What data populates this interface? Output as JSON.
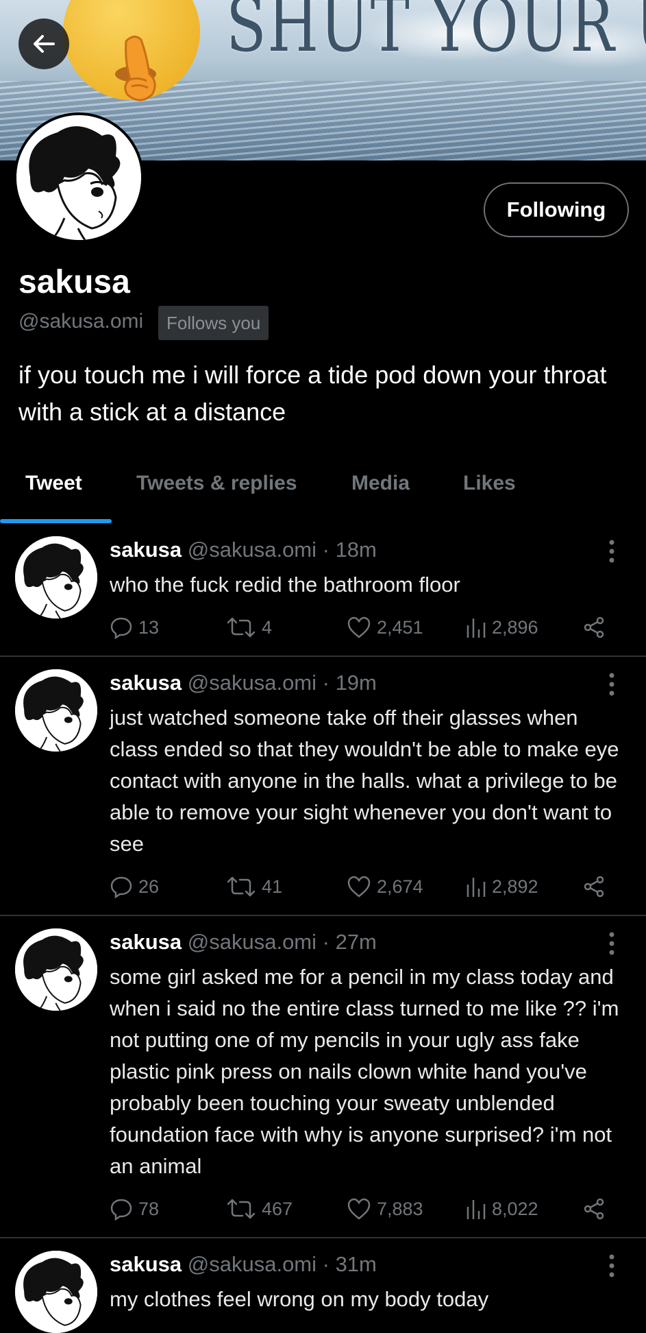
{
  "banner": {
    "text": "SHUT YOUR UP"
  },
  "profile": {
    "name": "sakusa",
    "handle": "@sakusa.omi",
    "follows_you": "Follows you",
    "follow_button": "Following",
    "bio": "if you touch me i will force a tide pod down your throat with a stick at a distance"
  },
  "tabs": [
    "Tweet",
    "Tweets & replies",
    "Media",
    "Likes"
  ],
  "tweets": [
    {
      "name": "sakusa",
      "meta": "@sakusa.omi · 18m",
      "text": "who the fuck redid the bathroom floor",
      "replies": "13",
      "retweets": "4",
      "likes": "2,451",
      "views": "2,896"
    },
    {
      "name": "sakusa",
      "meta": "@sakusa.omi · 19m",
      "text": "just watched someone take off their glasses when class ended so that they wouldn't be able to make eye contact with anyone in the halls. what a privilege to be able to remove your sight whenever you don't want to see",
      "replies": "26",
      "retweets": "41",
      "likes": "2,674",
      "views": "2,892"
    },
    {
      "name": "sakusa",
      "meta": "@sakusa.omi · 27m",
      "text": "some girl asked me for a pencil in my class today and when i said no the entire class turned to me like ?? i'm not putting one of my pencils in your ugly ass fake plastic pink press on nails clown white hand you've probably been touching your sweaty unblended foundation face with why is anyone surprised? i'm not an animal",
      "replies": "78",
      "retweets": "467",
      "likes": "7,883",
      "views": "8,022"
    },
    {
      "name": "sakusa",
      "meta": "@sakusa.omi · 31m",
      "text": "my clothes feel wrong on my body today"
    }
  ],
  "colors": {
    "accent": "#1d9bf0",
    "background": "#000000",
    "muted": "#71767b"
  },
  "icons": [
    "back-arrow-icon",
    "shush-emoji",
    "more-vert-icon",
    "reply-icon",
    "retweet-icon",
    "like-icon",
    "views-icon",
    "share-icon"
  ]
}
